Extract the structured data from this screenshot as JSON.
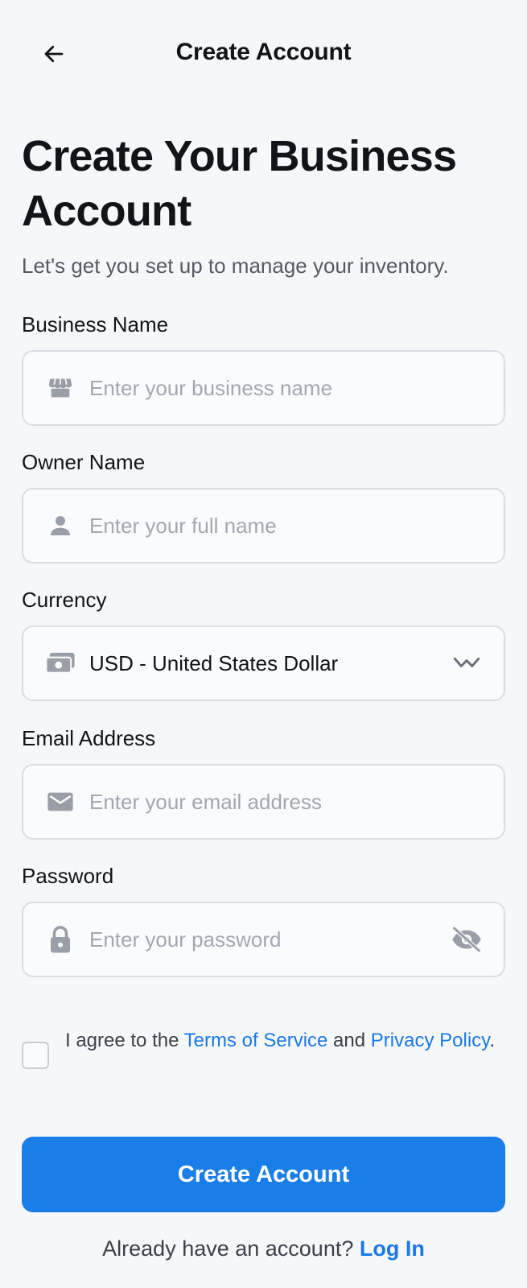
{
  "header": {
    "title": "Create Account",
    "back_icon": "arrow-left-icon"
  },
  "intro": {
    "headline": "Create Your Business Account",
    "subtitle": "Let's get you set up to manage your inventory."
  },
  "form": {
    "business_name": {
      "label": "Business Name",
      "placeholder": "Enter your business name",
      "icon": "storefront-icon"
    },
    "owner_name": {
      "label": "Owner Name",
      "placeholder": "Enter your full name",
      "icon": "person-icon"
    },
    "currency": {
      "label": "Currency",
      "value": "USD - United States Dollar",
      "icon": "money-icon",
      "chevron": "chevron-down-icon"
    },
    "email": {
      "label": "Email Address",
      "placeholder": "Enter your email address",
      "icon": "mail-icon"
    },
    "password": {
      "label": "Password",
      "placeholder": "Enter your password",
      "icon": "lock-icon",
      "toggle_icon": "eye-off-icon"
    }
  },
  "agreement": {
    "prefix": "I agree to the ",
    "terms": "Terms of Service",
    "middle": " and ",
    "privacy": "Privacy Policy",
    "suffix": ".",
    "checked": false
  },
  "submit_label": "Create Account",
  "footer": {
    "prompt": "Already have an account? ",
    "login": "Log In"
  },
  "colors": {
    "accent": "#1a7ee9",
    "link": "#1a79e6",
    "background": "#f6f7f9",
    "icon": "#9a9ea6"
  }
}
